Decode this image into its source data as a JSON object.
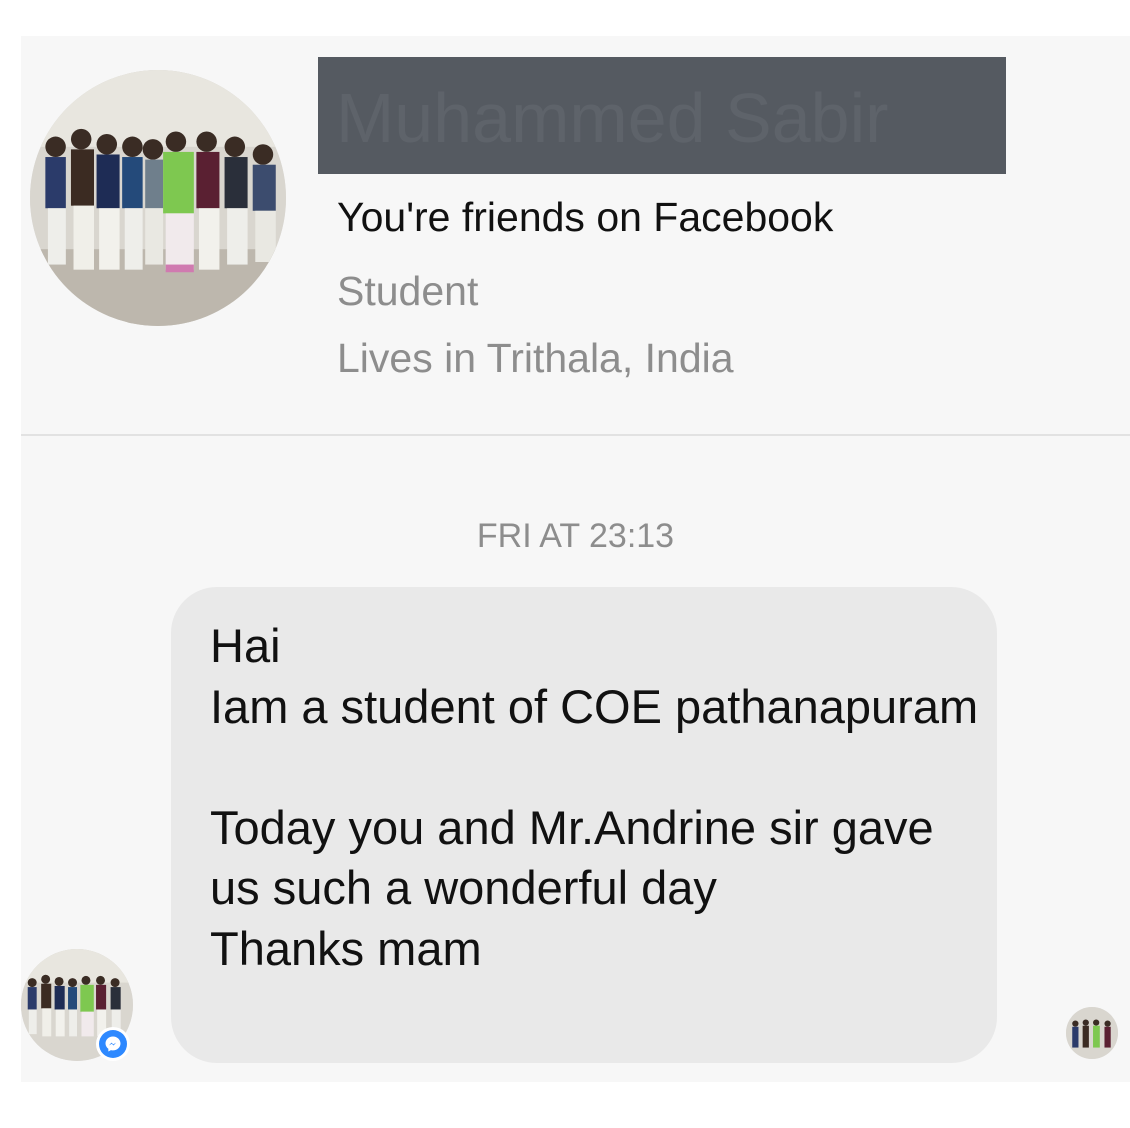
{
  "contact": {
    "name": "Muhammed Sabir",
    "friend_status": "You're friends on Facebook",
    "work": "Student",
    "location": "Lives in Trithala, India"
  },
  "conversation": {
    "timestamp": "FRI AT 23:13",
    "message": "Hai\nIam a student of COE pathanapuram\n\nToday you and Mr.Andrine sir gave us such a wonderful day\nThanks mam"
  },
  "icons": {
    "messenger_badge": "messenger-icon",
    "avatar": "group-photo-avatar"
  },
  "colors": {
    "background": "#f7f7f7",
    "bubble": "#e9e9e9",
    "name_redaction": "#555a61",
    "messenger_blue": "#2e89ff",
    "secondary_text": "#8d8d8d"
  }
}
